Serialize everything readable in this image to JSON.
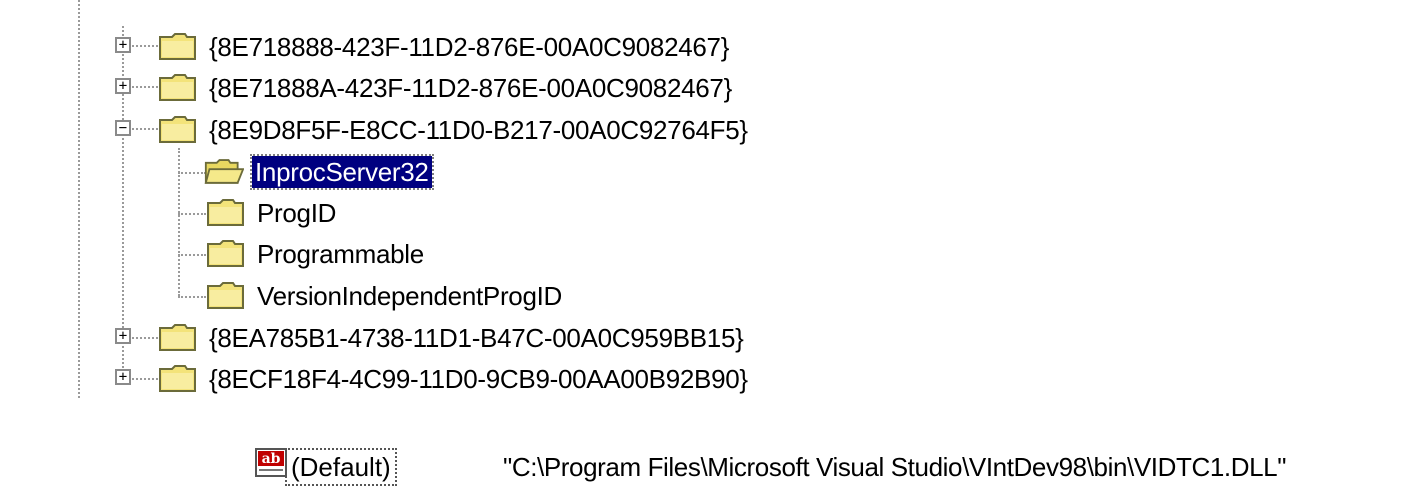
{
  "tree": {
    "nodes": [
      {
        "label": "{8E718888-423F-11D2-876E-00A0C9082467}",
        "expander": "+",
        "state": "collapsed"
      },
      {
        "label": "{8E71888A-423F-11D2-876E-00A0C9082467}",
        "expander": "+",
        "state": "collapsed"
      },
      {
        "label": "{8E9D8F5F-E8CC-11D0-B217-00A0C92764F5}",
        "expander": "−",
        "state": "expanded"
      },
      {
        "label": "InprocServer32",
        "state": "selected",
        "icon": "open-folder-icon"
      },
      {
        "label": "ProgID",
        "icon": "folder-icon"
      },
      {
        "label": "Programmable",
        "icon": "folder-icon"
      },
      {
        "label": "VersionIndependentProgID",
        "icon": "folder-icon"
      },
      {
        "label": "{8EA785B1-4738-11D1-B47C-00A0C959BB15}",
        "expander": "+",
        "state": "collapsed"
      },
      {
        "label": "{8ECF18F4-4C99-11D0-9CB9-00AA00B92B90}",
        "expander": "+",
        "state": "collapsed"
      }
    ]
  },
  "value": {
    "icon": "string-value-icon",
    "icon_text": "ab",
    "name": "(Default)",
    "data": "\"C:\\Program Files\\Microsoft Visual Studio\\VIntDev98\\bin\\VIDTC1.DLL\""
  },
  "colors": {
    "selection": "#000080",
    "folder": "#f3e37a",
    "tree_lines": "#9a9a9a"
  }
}
